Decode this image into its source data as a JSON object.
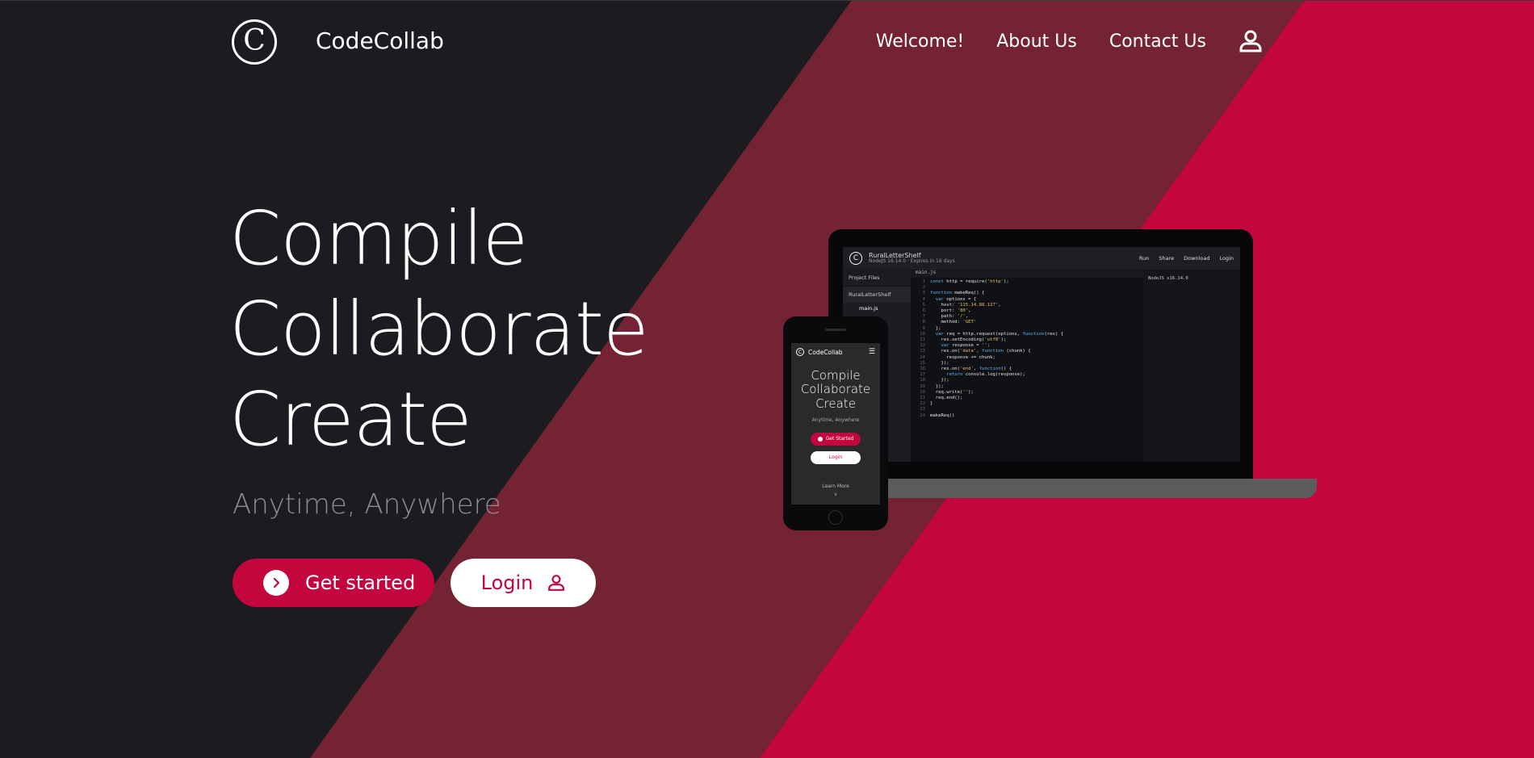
{
  "colors": {
    "dark": "#1c1b20",
    "maroon": "#732333",
    "accent": "#c4063e",
    "muted": "#8e8d92"
  },
  "nav": {
    "logo_letter": "C",
    "brand": "CodeCollab",
    "links": [
      "Welcome!",
      "About Us",
      "Contact Us"
    ],
    "user_icon": "user-icon"
  },
  "hero": {
    "lines": [
      "Compile",
      "Collaborate",
      "Create"
    ],
    "tagline": "Anytime, Anywhere",
    "get_started": "Get started",
    "login": "Login"
  },
  "laptop": {
    "project_name": "RuralLetterShelf",
    "project_meta": "NodeJS 16.14.0 · Expires in 16 days",
    "actions": [
      "Run",
      "Share",
      "Download",
      "Login"
    ],
    "sidebar_title": "Project Files",
    "folder": "RuralLetterShelf",
    "file": "main.js",
    "tab": "main.js",
    "output": "NodeJS v16.14.0",
    "code": [
      "const http = require('http');",
      "",
      "function makeReq() {",
      "  var options = {",
      "    host: '115.14.88.127',",
      "    port: '80',",
      "    path: '/',",
      "    method: 'GET'",
      "  };",
      "  var req = http.request(options, function(res) {",
      "    res.setEncoding('utf8');",
      "    var response = '';",
      "    res.on('data', function (chunk) {",
      "      response += chunk;",
      "    });",
      "    res.on('end', function() {",
      "      return console.log(response);",
      "    });",
      "  });",
      "  req.write('');",
      "  req.end();",
      "}",
      "",
      "makeReq()"
    ]
  },
  "phone": {
    "brand": "CodeCollab",
    "menu_icon": "hamburger-icon",
    "hero": [
      "Compile",
      "Collaborate",
      "Create"
    ],
    "tagline": "Anytime, Anywhere",
    "get_started": "Get Started",
    "login": "Login",
    "learn_more": "Learn More",
    "chevron": "v"
  }
}
